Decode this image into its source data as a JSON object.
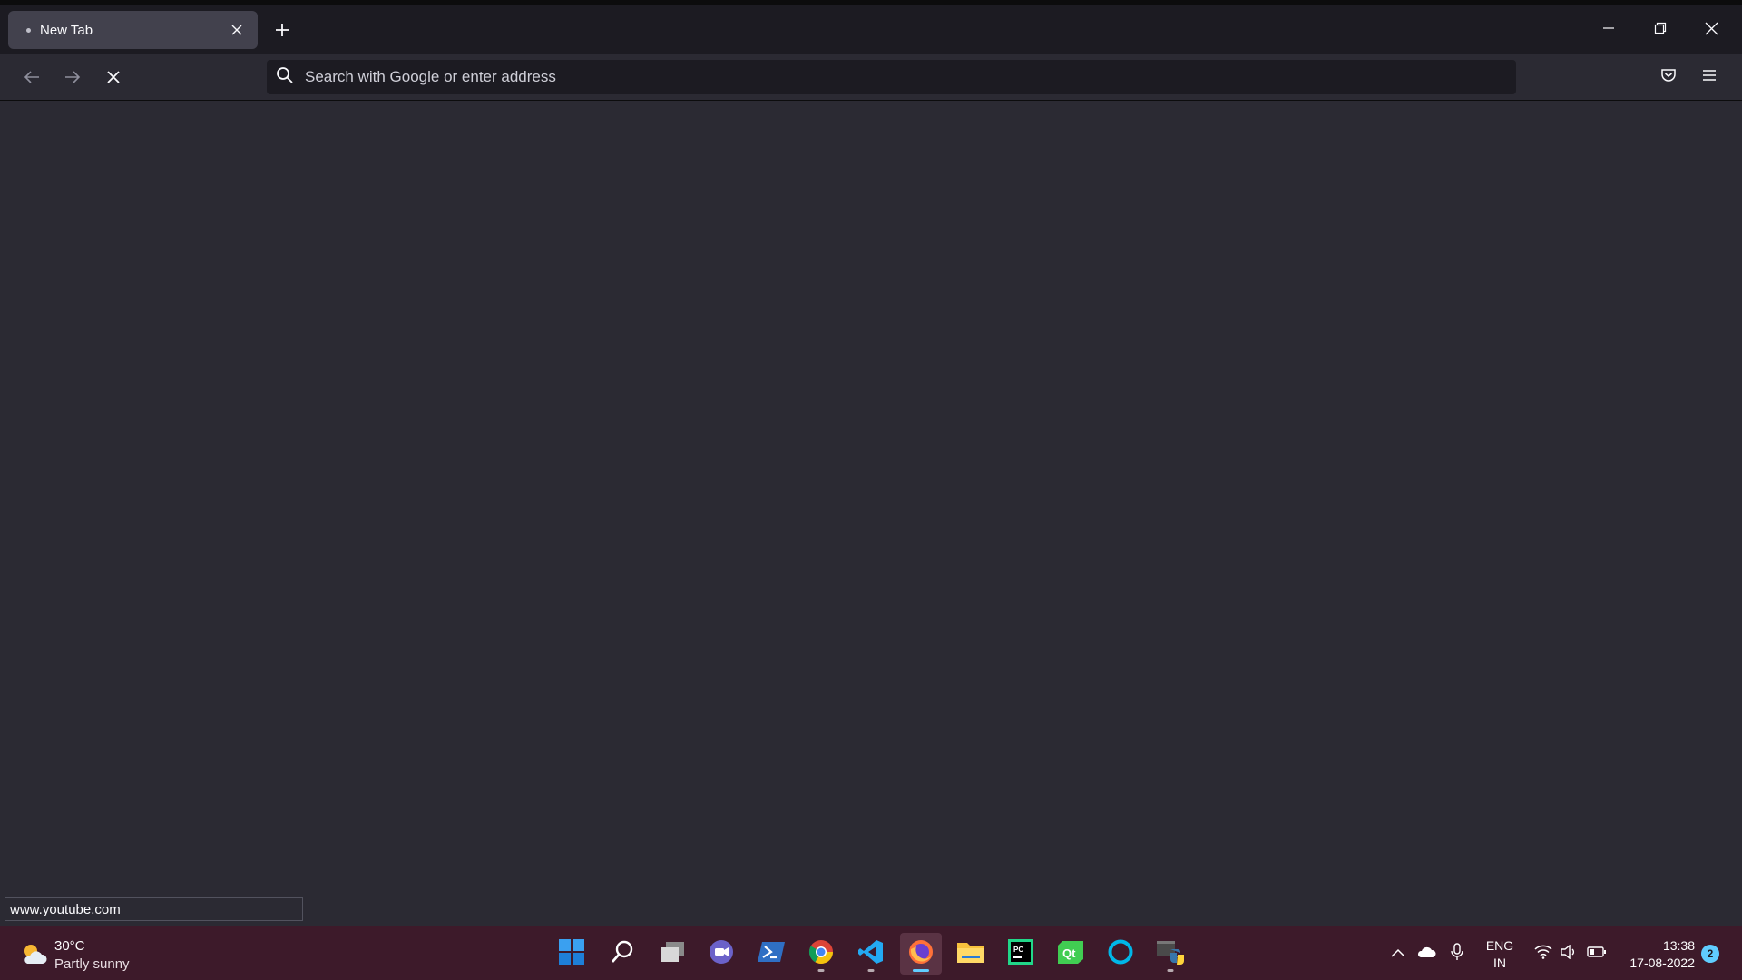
{
  "browser": {
    "tab": {
      "label": "New Tab"
    },
    "urlbar": {
      "placeholder": "Search with Google or enter address"
    },
    "status_text": "www.youtube.com"
  },
  "taskbar": {
    "weather": {
      "temp": "30°C",
      "desc": "Partly sunny"
    },
    "apps": [
      {
        "name": "start",
        "icon": "windows-start-icon"
      },
      {
        "name": "search",
        "icon": "search-icon"
      },
      {
        "name": "task-view",
        "icon": "task-view-icon"
      },
      {
        "name": "teams-chat",
        "icon": "video-chat-icon"
      },
      {
        "name": "powershell",
        "icon": "powershell-icon"
      },
      {
        "name": "chrome",
        "icon": "chrome-icon",
        "running": true
      },
      {
        "name": "vscode",
        "icon": "vscode-icon",
        "running": true
      },
      {
        "name": "firefox",
        "icon": "firefox-icon",
        "active": true
      },
      {
        "name": "file-explorer",
        "icon": "folder-icon"
      },
      {
        "name": "pycharm",
        "icon": "pycharm-icon"
      },
      {
        "name": "qt-creator",
        "icon": "qt-icon"
      },
      {
        "name": "cortana",
        "icon": "cortana-icon"
      },
      {
        "name": "python",
        "icon": "python-icon",
        "running": true
      }
    ],
    "language": {
      "line1": "ENG",
      "line2": "IN"
    },
    "clock": {
      "time": "13:38",
      "date": "17-08-2022"
    },
    "notifications": "2"
  },
  "colors": {
    "accent": "#60cdff",
    "taskbar_bg": "#3d1a2a",
    "browser_bg": "#2b2a33"
  }
}
